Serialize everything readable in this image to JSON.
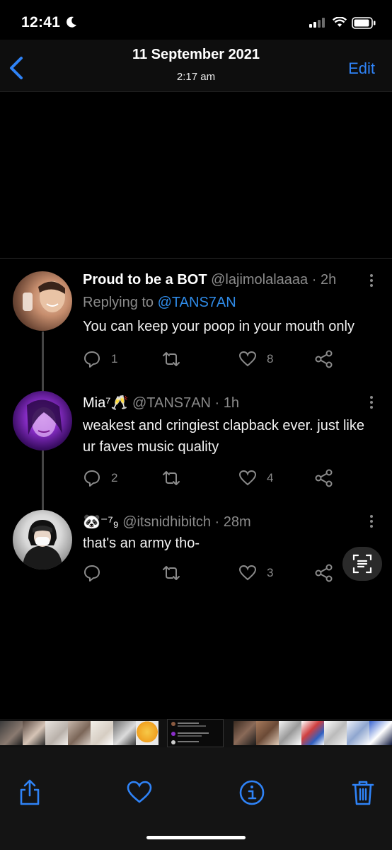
{
  "status_bar": {
    "time": "12:41"
  },
  "header": {
    "date": "11 September 2021",
    "time": "2:17 am",
    "edit_label": "Edit"
  },
  "tweets": [
    {
      "name": "Proud to be a BOT",
      "meta": "@lajimolalaaaa · 2h",
      "reply_prefix": "Replying to ",
      "reply_handle": "@TANS7AN",
      "text": "You can keep your poop in your mouth only",
      "replies": "1",
      "likes": "8"
    },
    {
      "name": "Mia⁷🥂",
      "meta": "@TANS7AN · 1h",
      "text": "weakest and cringiest clapback ever. just like ur faves music quality",
      "replies": "2",
      "likes": "4"
    },
    {
      "name": "🐼⁻⁷₉",
      "meta": "@itsnidhibitch · 28m",
      "text": "that's an army tho-",
      "replies": "",
      "likes": "3"
    }
  ],
  "colors": {
    "accent": "#2f83f7",
    "handle_blue": "#2f8be8",
    "muted": "#8b8b8b",
    "header_bg": "#0e0e0e",
    "toolbar_bg": "#141414"
  },
  "toolbar": {
    "icons": [
      "share-icon",
      "heart-icon",
      "info-icon",
      "trash-icon"
    ]
  }
}
